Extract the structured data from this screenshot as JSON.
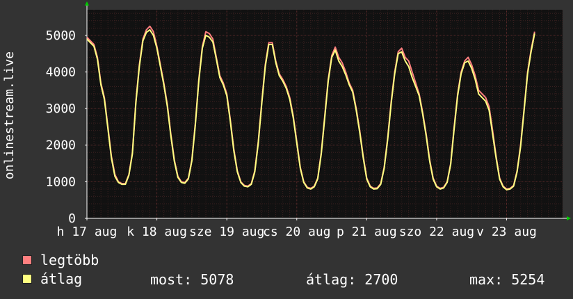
{
  "chart_data": {
    "type": "line",
    "title": "",
    "ylabel": "onlinestream.live",
    "xlabel": "",
    "ylim": [
      0,
      5700
    ],
    "yticks": [
      0,
      1000,
      2000,
      3000,
      4000,
      5000
    ],
    "ytick_labels": [
      "0",
      "1000",
      "2000",
      "3000",
      "4000",
      "5000"
    ],
    "xlim": [
      0,
      136
    ],
    "x_tick_labels": [
      {
        "t": 0,
        "label": "h 17 aug"
      },
      {
        "t": 20,
        "label": "k 18 aug"
      },
      {
        "t": 40,
        "label": "sze 19 aug"
      },
      {
        "t": 60,
        "label": "cs 20 aug"
      },
      {
        "t": 80,
        "label": "p 21 aug"
      },
      {
        "t": 100,
        "label": "szo 22 aug"
      },
      {
        "t": 120,
        "label": "v 23 aug"
      }
    ],
    "grid": true,
    "series": [
      {
        "name": "legtöbb",
        "color": "#ff7f7f",
        "points": [
          [
            0,
            4950
          ],
          [
            1,
            4850
          ],
          [
            2,
            4750
          ],
          [
            3,
            4400
          ],
          [
            4,
            3700
          ],
          [
            5,
            3300
          ],
          [
            6,
            2500
          ],
          [
            7,
            1700
          ],
          [
            8,
            1200
          ],
          [
            9,
            1000
          ],
          [
            10,
            950
          ],
          [
            11,
            950
          ],
          [
            12,
            1200
          ],
          [
            13,
            1800
          ],
          [
            14,
            3200
          ],
          [
            15,
            4200
          ],
          [
            16,
            4900
          ],
          [
            17,
            5150
          ],
          [
            18,
            5250
          ],
          [
            19,
            5100
          ],
          [
            20,
            4700
          ],
          [
            21,
            4200
          ],
          [
            22,
            3700
          ],
          [
            23,
            3100
          ],
          [
            24,
            2300
          ],
          [
            25,
            1600
          ],
          [
            26,
            1150
          ],
          [
            27,
            1000
          ],
          [
            28,
            980
          ],
          [
            29,
            1100
          ],
          [
            30,
            1600
          ],
          [
            31,
            2600
          ],
          [
            32,
            3800
          ],
          [
            33,
            4700
          ],
          [
            34,
            5100
          ],
          [
            35,
            5050
          ],
          [
            36,
            4900
          ],
          [
            37,
            4400
          ],
          [
            38,
            3900
          ],
          [
            39,
            3700
          ],
          [
            40,
            3400
          ],
          [
            41,
            2700
          ],
          [
            42,
            1900
          ],
          [
            43,
            1300
          ],
          [
            44,
            1000
          ],
          [
            45,
            900
          ],
          [
            46,
            880
          ],
          [
            47,
            950
          ],
          [
            48,
            1300
          ],
          [
            49,
            2100
          ],
          [
            50,
            3200
          ],
          [
            51,
            4200
          ],
          [
            52,
            4800
          ],
          [
            53,
            4800
          ],
          [
            54,
            4300
          ],
          [
            55,
            3950
          ],
          [
            56,
            3800
          ],
          [
            57,
            3600
          ],
          [
            58,
            3300
          ],
          [
            59,
            2800
          ],
          [
            60,
            2100
          ],
          [
            61,
            1400
          ],
          [
            62,
            1000
          ],
          [
            63,
            850
          ],
          [
            64,
            820
          ],
          [
            65,
            880
          ],
          [
            66,
            1100
          ],
          [
            67,
            1800
          ],
          [
            68,
            2800
          ],
          [
            69,
            3800
          ],
          [
            70,
            4450
          ],
          [
            71,
            4680
          ],
          [
            72,
            4400
          ],
          [
            73,
            4250
          ],
          [
            74,
            4000
          ],
          [
            75,
            3700
          ],
          [
            76,
            3500
          ],
          [
            77,
            3000
          ],
          [
            78,
            2400
          ],
          [
            79,
            1700
          ],
          [
            80,
            1100
          ],
          [
            81,
            880
          ],
          [
            82,
            820
          ],
          [
            83,
            830
          ],
          [
            84,
            950
          ],
          [
            85,
            1400
          ],
          [
            86,
            2200
          ],
          [
            87,
            3200
          ],
          [
            88,
            4000
          ],
          [
            89,
            4550
          ],
          [
            90,
            4650
          ],
          [
            91,
            4400
          ],
          [
            92,
            4300
          ],
          [
            93,
            4000
          ],
          [
            94,
            3700
          ],
          [
            95,
            3400
          ],
          [
            96,
            2900
          ],
          [
            97,
            2300
          ],
          [
            98,
            1600
          ],
          [
            99,
            1100
          ],
          [
            100,
            880
          ],
          [
            101,
            820
          ],
          [
            102,
            850
          ],
          [
            103,
            1000
          ],
          [
            104,
            1500
          ],
          [
            105,
            2500
          ],
          [
            106,
            3400
          ],
          [
            107,
            4000
          ],
          [
            108,
            4300
          ],
          [
            109,
            4400
          ],
          [
            110,
            4200
          ],
          [
            111,
            3900
          ],
          [
            112,
            3500
          ],
          [
            113,
            3400
          ],
          [
            114,
            3300
          ],
          [
            115,
            3050
          ],
          [
            116,
            2400
          ],
          [
            117,
            1700
          ],
          [
            118,
            1100
          ],
          [
            119,
            880
          ],
          [
            120,
            800
          ],
          [
            121,
            820
          ],
          [
            122,
            900
          ],
          [
            123,
            1300
          ],
          [
            124,
            2000
          ],
          [
            125,
            3000
          ],
          [
            126,
            4000
          ],
          [
            127,
            4600
          ],
          [
            128,
            5100
          ]
        ]
      },
      {
        "name": "átlag",
        "color": "#ffff80",
        "points": [
          [
            0,
            4900
          ],
          [
            1,
            4800
          ],
          [
            2,
            4700
          ],
          [
            3,
            4350
          ],
          [
            4,
            3650
          ],
          [
            5,
            3250
          ],
          [
            6,
            2450
          ],
          [
            7,
            1650
          ],
          [
            8,
            1150
          ],
          [
            9,
            980
          ],
          [
            10,
            930
          ],
          [
            11,
            930
          ],
          [
            12,
            1180
          ],
          [
            13,
            1760
          ],
          [
            14,
            3150
          ],
          [
            15,
            4150
          ],
          [
            16,
            4850
          ],
          [
            17,
            5080
          ],
          [
            18,
            5150
          ],
          [
            19,
            5000
          ],
          [
            20,
            4650
          ],
          [
            21,
            4150
          ],
          [
            22,
            3650
          ],
          [
            23,
            3050
          ],
          [
            24,
            2250
          ],
          [
            25,
            1560
          ],
          [
            26,
            1120
          ],
          [
            27,
            980
          ],
          [
            28,
            960
          ],
          [
            29,
            1080
          ],
          [
            30,
            1570
          ],
          [
            31,
            2550
          ],
          [
            32,
            3750
          ],
          [
            33,
            4650
          ],
          [
            34,
            5000
          ],
          [
            35,
            4950
          ],
          [
            36,
            4820
          ],
          [
            37,
            4350
          ],
          [
            38,
            3850
          ],
          [
            39,
            3650
          ],
          [
            40,
            3350
          ],
          [
            41,
            2650
          ],
          [
            42,
            1850
          ],
          [
            43,
            1270
          ],
          [
            44,
            980
          ],
          [
            45,
            880
          ],
          [
            46,
            860
          ],
          [
            47,
            930
          ],
          [
            48,
            1270
          ],
          [
            49,
            2050
          ],
          [
            50,
            3150
          ],
          [
            51,
            4150
          ],
          [
            52,
            4750
          ],
          [
            53,
            4750
          ],
          [
            54,
            4250
          ],
          [
            55,
            3900
          ],
          [
            56,
            3750
          ],
          [
            57,
            3550
          ],
          [
            58,
            3250
          ],
          [
            59,
            2750
          ],
          [
            60,
            2050
          ],
          [
            61,
            1370
          ],
          [
            62,
            980
          ],
          [
            63,
            830
          ],
          [
            64,
            800
          ],
          [
            65,
            860
          ],
          [
            66,
            1080
          ],
          [
            67,
            1760
          ],
          [
            68,
            2750
          ],
          [
            69,
            3750
          ],
          [
            70,
            4400
          ],
          [
            71,
            4600
          ],
          [
            72,
            4300
          ],
          [
            73,
            4150
          ],
          [
            74,
            3920
          ],
          [
            75,
            3650
          ],
          [
            76,
            3450
          ],
          [
            77,
            2950
          ],
          [
            78,
            2350
          ],
          [
            79,
            1660
          ],
          [
            80,
            1070
          ],
          [
            81,
            860
          ],
          [
            82,
            800
          ],
          [
            83,
            810
          ],
          [
            84,
            930
          ],
          [
            85,
            1370
          ],
          [
            86,
            2150
          ],
          [
            87,
            3150
          ],
          [
            88,
            3950
          ],
          [
            89,
            4500
          ],
          [
            90,
            4550
          ],
          [
            91,
            4300
          ],
          [
            92,
            4150
          ],
          [
            93,
            3850
          ],
          [
            94,
            3600
          ],
          [
            95,
            3350
          ],
          [
            96,
            2850
          ],
          [
            97,
            2250
          ],
          [
            98,
            1560
          ],
          [
            99,
            1070
          ],
          [
            100,
            860
          ],
          [
            101,
            800
          ],
          [
            102,
            830
          ],
          [
            103,
            980
          ],
          [
            104,
            1470
          ],
          [
            105,
            2450
          ],
          [
            106,
            3350
          ],
          [
            107,
            3950
          ],
          [
            108,
            4250
          ],
          [
            109,
            4300
          ],
          [
            110,
            4100
          ],
          [
            111,
            3800
          ],
          [
            112,
            3400
          ],
          [
            113,
            3300
          ],
          [
            114,
            3200
          ],
          [
            115,
            2950
          ],
          [
            116,
            2300
          ],
          [
            117,
            1650
          ],
          [
            118,
            1070
          ],
          [
            119,
            860
          ],
          [
            120,
            780
          ],
          [
            121,
            800
          ],
          [
            122,
            880
          ],
          [
            123,
            1270
          ],
          [
            124,
            1950
          ],
          [
            125,
            2950
          ],
          [
            126,
            3950
          ],
          [
            127,
            4550
          ],
          [
            128,
            5050
          ]
        ]
      }
    ]
  },
  "legend": {
    "max_label": "legtöbb",
    "avg_label": "átlag",
    "max_color": "#ff7f7f",
    "avg_color": "#ffff80"
  },
  "stats": {
    "now": "most: 5078",
    "avg": "átlag: 2700",
    "max": "max: 5254"
  }
}
